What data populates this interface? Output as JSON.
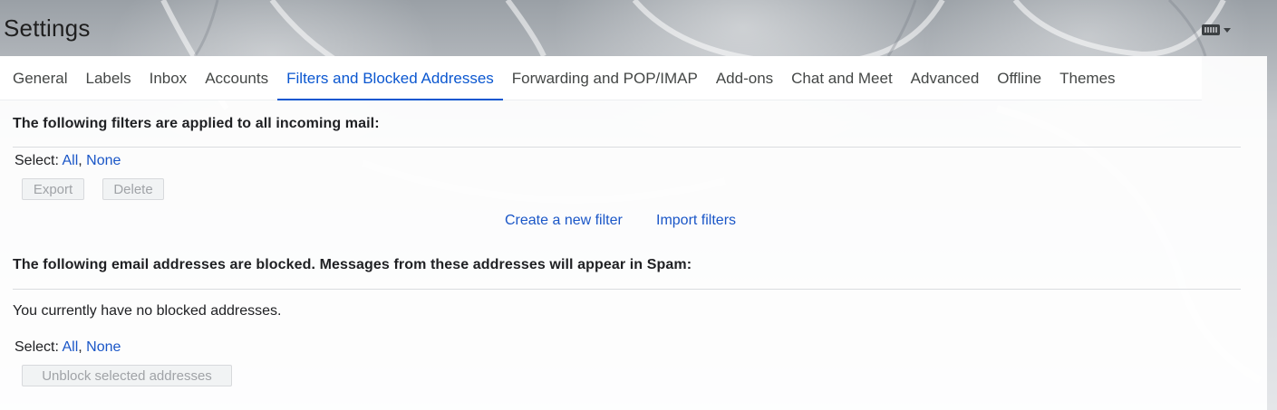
{
  "header": {
    "title": "Settings"
  },
  "tabs": [
    {
      "label": "General",
      "active": false
    },
    {
      "label": "Labels",
      "active": false
    },
    {
      "label": "Inbox",
      "active": false
    },
    {
      "label": "Accounts",
      "active": false
    },
    {
      "label": "Filters and Blocked Addresses",
      "active": true
    },
    {
      "label": "Forwarding and POP/IMAP",
      "active": false
    },
    {
      "label": "Add-ons",
      "active": false
    },
    {
      "label": "Chat and Meet",
      "active": false
    },
    {
      "label": "Advanced",
      "active": false
    },
    {
      "label": "Offline",
      "active": false
    },
    {
      "label": "Themes",
      "active": false
    }
  ],
  "filters": {
    "heading": "The following filters are applied to all incoming mail:",
    "select_label": "Select:",
    "select_all": "All",
    "separator": ",",
    "select_none": "None",
    "export_label": "Export",
    "delete_label": "Delete",
    "create_filter_link": "Create a new filter",
    "import_filters_link": "Import filters"
  },
  "blocked": {
    "heading": "The following email addresses are blocked. Messages from these addresses will appear in Spam:",
    "empty_message": "You currently have no blocked addresses.",
    "select_label": "Select:",
    "select_all": "All",
    "separator": ",",
    "select_none": "None",
    "unblock_label": "Unblock selected addresses"
  },
  "colors": {
    "accent": "#0b57d0",
    "link": "#1a56c7",
    "disabled_text": "#a0a3a7"
  },
  "icons": {
    "keyboard": "keyboard-icon",
    "dropdown": "caret-down-icon"
  }
}
